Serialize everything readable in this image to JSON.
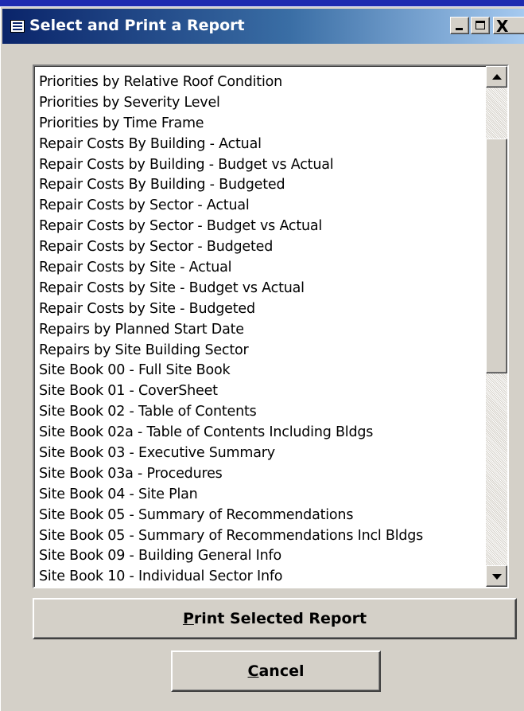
{
  "window": {
    "title": "Select and Print a Report",
    "icon": "form-icon",
    "controls": {
      "minimize_icon": "minimize-icon",
      "maximize_icon": "maximize-icon",
      "close_label": "X"
    }
  },
  "report_list": {
    "items": [
      "Priorities by Relative Roof Condition",
      "Priorities by Severity Level",
      "Priorities by Time Frame",
      "Repair Costs By Building - Actual",
      "Repair Costs by Building - Budget vs Actual",
      "Repair Costs By Building - Budgeted",
      "Repair Costs by Sector - Actual",
      "Repair Costs by Sector - Budget vs Actual",
      "Repair Costs by Sector - Budgeted",
      "Repair Costs by Site - Actual",
      "Repair Costs by Site - Budget vs Actual",
      "Repair Costs by Site - Budgeted",
      "Repairs by Planned Start Date",
      "Repairs by Site Building Sector",
      "Site Book 00 - Full Site Book",
      "Site Book 01 - CoverSheet",
      "Site Book 02 - Table of Contents",
      "Site Book 02a - Table of Contents Including Bldgs",
      "Site Book 03 - Executive Summary",
      "Site Book 03a - Procedures",
      "Site Book 04 - Site Plan",
      "Site Book 05 - Summary of Recommendations",
      "Site Book 05 - Summary of Recommendations Incl Bldgs",
      "Site Book 09 - Building General Info",
      "Site Book 10 - Individual Sector Info"
    ]
  },
  "buttons": {
    "print": {
      "mnemonic": "P",
      "rest": "rint Selected Report"
    },
    "cancel": {
      "mnemonic": "C",
      "rest": "ancel"
    }
  },
  "colors": {
    "desktop": "#1e2bb0",
    "titlebar_start": "#0a246a",
    "titlebar_end": "#a6caf0",
    "face": "#d4d0c8"
  }
}
